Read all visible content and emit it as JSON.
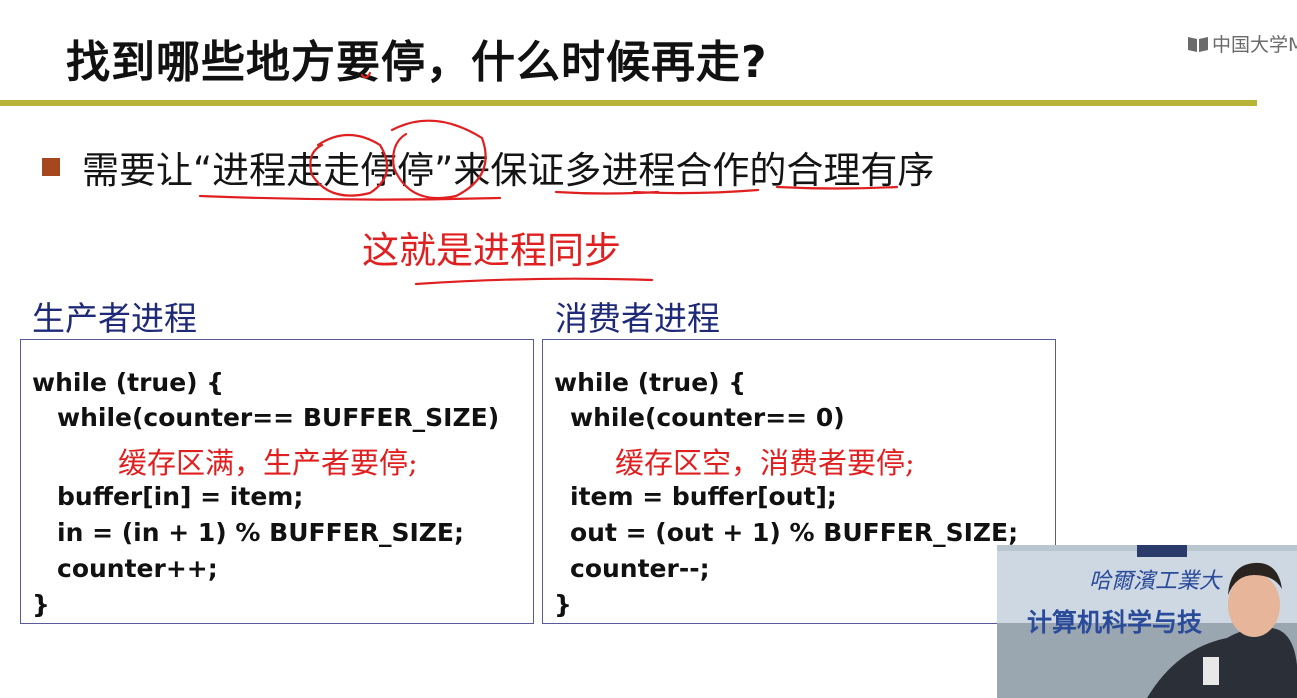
{
  "slide": {
    "title": "找到哪些地方要停，什么时候再走?",
    "watermark": "中国大学M",
    "bullet": "需要让“进程走走停停”来保证多进程合作的合理有序",
    "sync_note": "这就是进程同步"
  },
  "producer": {
    "label": "生产者进程",
    "lines": [
      "while (true) {",
      "while(counter== BUFFER_SIZE)",
      "缓存区满，生产者要停;",
      "buffer[in] = item;",
      "in = (in + 1) % BUFFER_SIZE;",
      "counter++;",
      "}"
    ]
  },
  "consumer": {
    "label": "消费者进程",
    "lines": [
      "while (true) {",
      "while(counter== 0)",
      "缓存区空，消费者要停;",
      "item = buffer[out];",
      "out = (out + 1) % BUFFER_SIZE;",
      "counter--;",
      "}"
    ]
  },
  "video": {
    "sign_line1": "哈爾濱工業大",
    "sign_line2": "计算机科学与技"
  },
  "colors": {
    "rule": "#b8b43a",
    "bullet": "#a5481f",
    "annotation": "#e02020",
    "label": "#1e2a78"
  }
}
